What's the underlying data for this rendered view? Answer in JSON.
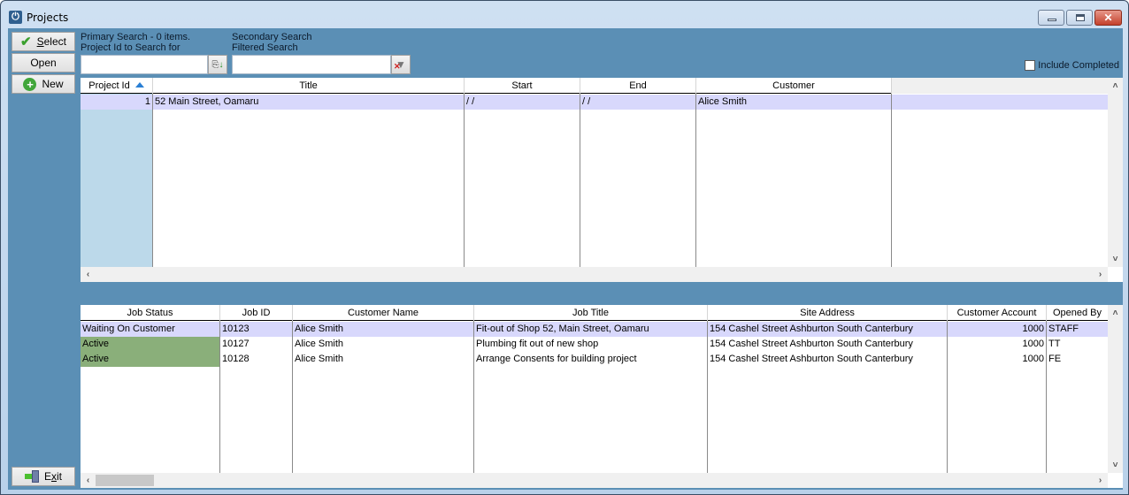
{
  "window": {
    "title": "Projects",
    "icon": "power-icon",
    "controls": {
      "minimize": "minimize",
      "maximize": "maximize",
      "close": "✕"
    }
  },
  "sidebar": {
    "select": {
      "label_u": "S",
      "label_rest": "elect",
      "icon": "checkmark-icon"
    },
    "open": {
      "label": "Open"
    },
    "new": {
      "label": "New",
      "icon": "plus-circle-icon"
    },
    "exit": {
      "label_pre": "E",
      "label_u": "x",
      "label_rest": "it",
      "icon": "exit-door-icon"
    }
  },
  "search": {
    "primary_line1": "Primary Search - 0 items.",
    "primary_line2": "Project Id to Search for",
    "primary_value": "",
    "primary_button_icon": "copy-sort-down-icon",
    "secondary_line1": "Secondary Search",
    "secondary_line2": "Filtered Search",
    "secondary_value": "",
    "secondary_button_icon": "clear-filter-icon",
    "include_completed_label": "Include Completed",
    "include_completed_checked": false
  },
  "projects": {
    "columns": [
      "Project Id",
      "Title",
      "Start",
      "End",
      "Customer"
    ],
    "sort_column": "Project Id",
    "sort_direction": "ascending",
    "rows": [
      {
        "id": "1",
        "title": "52 Main Street, Oamaru",
        "start": "/ /",
        "end": "/ /",
        "customer": "Alice Smith"
      }
    ]
  },
  "jobs": {
    "columns": [
      "Job Status",
      "Job ID",
      "Customer Name",
      "Job Title",
      "Site Address",
      "Customer Account",
      "Opened By"
    ],
    "rows": [
      {
        "status": "Waiting On Customer",
        "job_id": "10123",
        "customer": "Alice Smith",
        "title": "Fit-out of Shop 52, Main Street, Oamaru",
        "address": "154 Cashel Street Ashburton South Canterbury",
        "account": "1000",
        "opened_by": "STAFF",
        "selected": true
      },
      {
        "status": "Active",
        "job_id": "10127",
        "customer": "Alice Smith",
        "title": "Plumbing fit out of new shop",
        "address": "154 Cashel Street Ashburton South Canterbury",
        "account": "1000",
        "opened_by": "TT",
        "selected": false
      },
      {
        "status": "Active",
        "job_id": "10128",
        "customer": "Alice Smith",
        "title": "Arrange Consents for building project",
        "address": "154 Cashel Street Ashburton South Canterbury",
        "account": "1000",
        "opened_by": "FE",
        "selected": false
      }
    ]
  },
  "colors": {
    "panel_bg": "#5b8fb5",
    "selected_row": "#d8d8fc",
    "active_status": "#8aaf7a",
    "id_column_bg": "#bcd9ea"
  }
}
